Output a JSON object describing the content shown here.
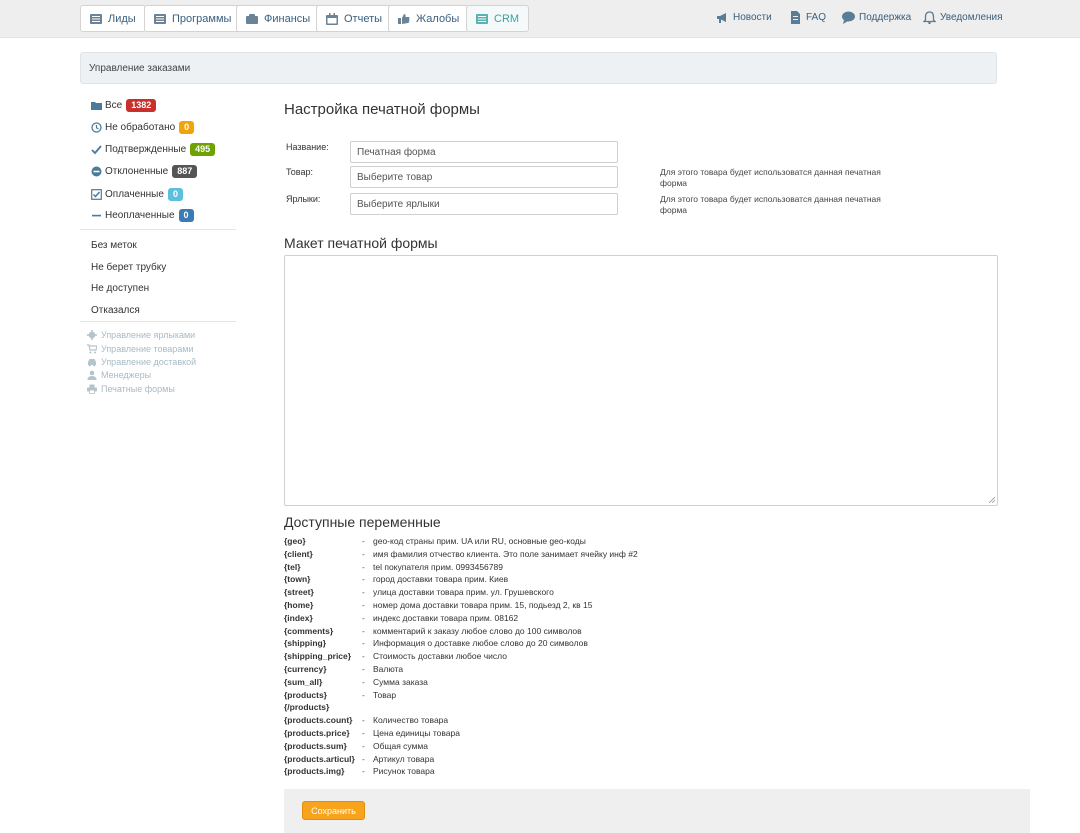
{
  "nav": {
    "tabs": [
      {
        "label": "Лиды",
        "icon": "list-icon"
      },
      {
        "label": "Программы",
        "icon": "list-icon"
      },
      {
        "label": "Финансы",
        "icon": "wallet-icon"
      },
      {
        "label": "Отчеты",
        "icon": "calendar-icon"
      },
      {
        "label": "Жалобы",
        "icon": "thumbs-down-icon"
      },
      {
        "label": "CRM",
        "icon": "list-icon",
        "active": true
      }
    ],
    "links": [
      {
        "label": "Новости",
        "icon": "megaphone-icon"
      },
      {
        "label": "FAQ",
        "icon": "document-icon"
      },
      {
        "label": "Поддержка",
        "icon": "chat-icon"
      },
      {
        "label": "Уведомления",
        "icon": "bell-icon"
      }
    ]
  },
  "breadcrumb": "Управление заказами",
  "sidebar": {
    "statuses": [
      {
        "label": "Все",
        "count": "1382",
        "color": "#c9302c",
        "icon": "folder-icon"
      },
      {
        "label": "Не обработано",
        "count": "0",
        "color": "#f0a30a",
        "icon": "clock-icon"
      },
      {
        "label": "Подтвержденные",
        "count": "495",
        "color": "#6ea200",
        "icon": "check-icon"
      },
      {
        "label": "Отклоненные",
        "count": "887",
        "color": "#555555",
        "icon": "minus-circle-icon"
      },
      {
        "label": "Оплаченные",
        "count": "0",
        "color": "#5bc0de",
        "icon": "checkbox-icon"
      },
      {
        "label": "Неоплаченные",
        "count": "0",
        "color": "#3a7ab5",
        "icon": "minus-icon"
      }
    ],
    "tags": [
      "Без меток",
      "Не берет трубку",
      "Не доступен",
      "Отказался"
    ],
    "management": [
      {
        "label": "Управление ярлыками",
        "icon": "gear-icon"
      },
      {
        "label": "Управление товарами",
        "icon": "cart-icon"
      },
      {
        "label": "Управление доставкой",
        "icon": "car-icon"
      },
      {
        "label": "Менеджеры",
        "icon": "user-icon"
      },
      {
        "label": "Печатные формы",
        "icon": "printer-icon"
      }
    ]
  },
  "form": {
    "title": "Настройка печатной формы",
    "name_label": "Название:",
    "name_value": "Печатная форма",
    "product_label": "Товар:",
    "product_placeholder": "Выберите товар",
    "product_hint": "Для этого товара будет использоватся данная печатная форма",
    "labels_label": "Ярлыки:",
    "labels_placeholder": "Выберите ярлыки",
    "labels_hint": "Для этого товара будет использоватся данная печатная форма"
  },
  "layout_section": {
    "title": "Макет печатной формы",
    "content": ""
  },
  "variables": {
    "title": "Доступные переменные",
    "items": [
      {
        "key": "{geo}",
        "dash": "-",
        "desc": "geo-код страны прим. UA или RU, основные geo-коды"
      },
      {
        "key": "{client}",
        "dash": "-",
        "desc": "имя фамилия отчество клиента. Это поле занимает ячейку инф #2"
      },
      {
        "key": "{tel}",
        "dash": "-",
        "desc": "tel покупателя прим. 0993456789"
      },
      {
        "key": "{town}",
        "dash": "-",
        "desc": "город доставки товара прим. Киев"
      },
      {
        "key": "{street}",
        "dash": "-",
        "desc": "улица доставки товара прим. ул. Грушевского"
      },
      {
        "key": "{home}",
        "dash": "-",
        "desc": "номер дома доставки товара прим. 15, подьезд 2, кв 15"
      },
      {
        "key": "{index}",
        "dash": "-",
        "desc": "индекс доставки товара прим. 08162"
      },
      {
        "key": "{comments}",
        "dash": "-",
        "desc": "комментарий к заказу любое слово до 100 символов"
      },
      {
        "key": "{shipping}",
        "dash": "-",
        "desc": "Информация о доставке любое слово до 20 символов"
      },
      {
        "key": "{shipping_price}",
        "dash": "-",
        "desc": "Стоимость доставки любое число"
      },
      {
        "key": "{currency}",
        "dash": "-",
        "desc": "Валюта"
      },
      {
        "key": "{sum_all}",
        "dash": "-",
        "desc": "Сумма заказа"
      },
      {
        "key": "{products}",
        "dash": "-",
        "desc": "Товар"
      },
      {
        "key": "{/products}",
        "dash": "",
        "desc": ""
      },
      {
        "key": "{products.count}",
        "dash": "-",
        "desc": "Количество товара"
      },
      {
        "key": "{products.price}",
        "dash": "-",
        "desc": "Цена единицы товара"
      },
      {
        "key": "{products.sum}",
        "dash": "-",
        "desc": "Общая сумма"
      },
      {
        "key": "{products.articul}",
        "dash": "-",
        "desc": "Артикул товара"
      },
      {
        "key": "{products.img}",
        "dash": "-",
        "desc": "Рисунок товара"
      }
    ]
  },
  "save_label": "Сохранить"
}
